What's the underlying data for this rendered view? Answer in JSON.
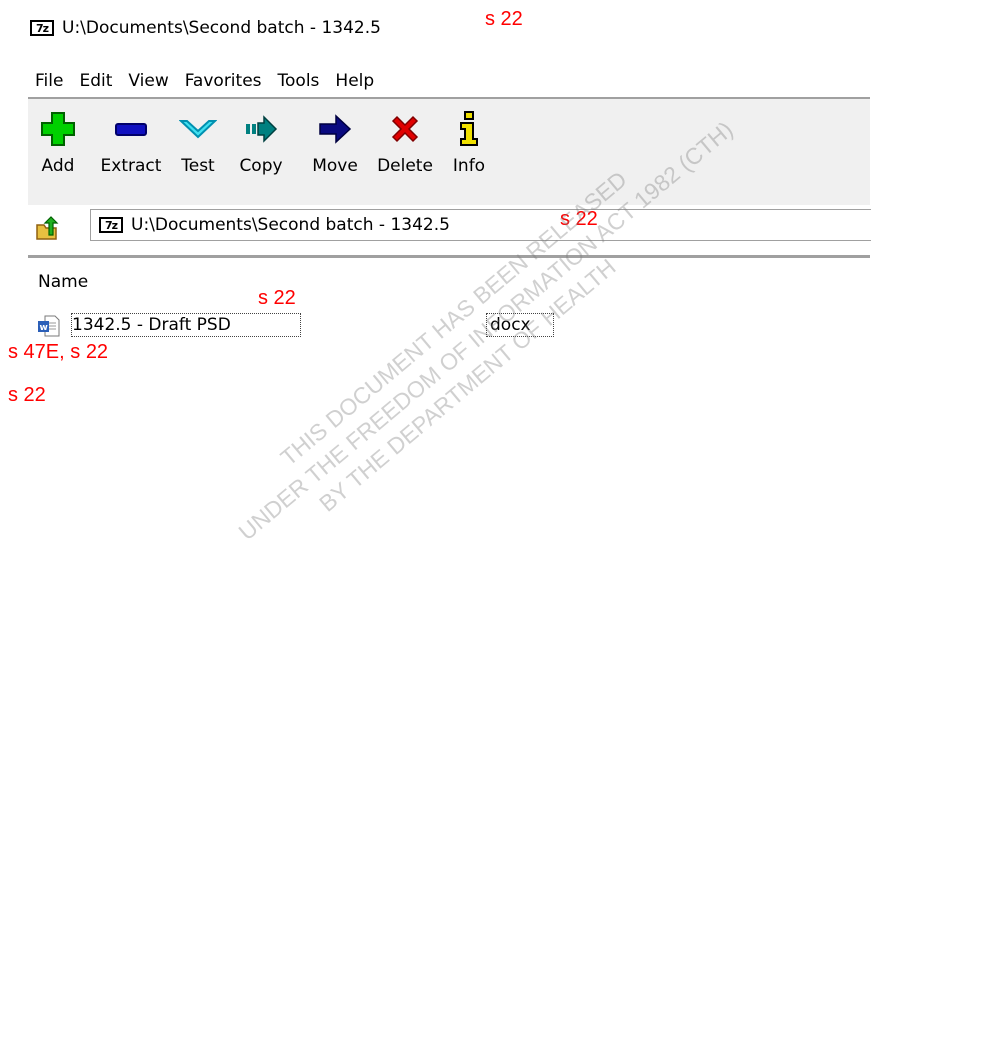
{
  "window": {
    "icon": "7z",
    "title": "U:\\Documents\\Second batch - 1342.5",
    "redaction": "s 22"
  },
  "menu": [
    "File",
    "Edit",
    "View",
    "Favorites",
    "Tools",
    "Help"
  ],
  "toolbar": [
    {
      "label": "Add",
      "icon": "plus-icon",
      "color": "#00c800"
    },
    {
      "label": "Extract",
      "icon": "minus-icon",
      "color": "#0000a0"
    },
    {
      "label": "Test",
      "icon": "check-chevron-icon",
      "color": "#00c8e6"
    },
    {
      "label": "Copy",
      "icon": "copy-arrow-icon",
      "color": "#008080"
    },
    {
      "label": "Move",
      "icon": "move-arrow-icon",
      "color": "#00007a"
    },
    {
      "label": "Delete",
      "icon": "delete-x-icon",
      "color": "#e00000"
    },
    {
      "label": "Info",
      "icon": "info-icon",
      "color": "#f0e000"
    }
  ],
  "address": {
    "icon": "7z",
    "path": "U:\\Documents\\Second batch - 1342.5",
    "redaction": "s 22"
  },
  "list": {
    "column_name": "Name",
    "rows": [
      {
        "name": "1342.5 - Draft PSD",
        "extension": "docx",
        "redaction": "s 22"
      }
    ]
  },
  "redactions": {
    "left_1": "s 47E, s 22",
    "left_2": "s 22"
  },
  "watermark": [
    "THIS DOCUMENT HAS BEEN RELEASED",
    "UNDER THE FREEDOM OF INFORMATION ACT 1982 (CTH)",
    "BY THE DEPARTMENT OF HEALTH"
  ]
}
